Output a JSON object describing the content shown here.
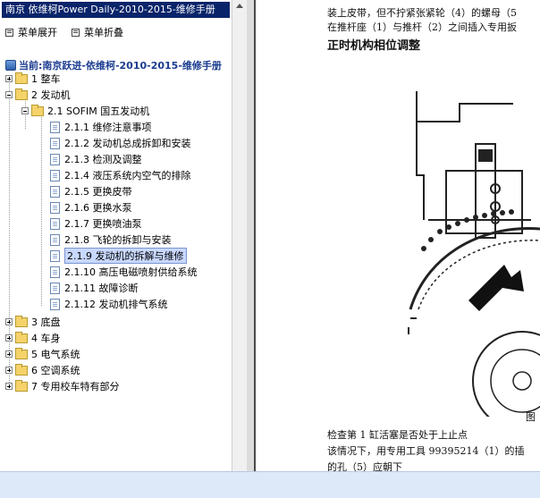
{
  "window": {
    "title": "南京 依维柯Power Daily-2010-2015-维修手册"
  },
  "menu": {
    "expand_label": "菜单展开",
    "collapse_label": "菜单折叠"
  },
  "current": {
    "label": "当前:南京跃进-依维柯-2010-2015-维修手册"
  },
  "tree": {
    "n1": "1 整车",
    "n2": "2 发动机",
    "n21": "2.1 SOFIM 国五发动机",
    "leaves": [
      "2.1.1 维修注意事项",
      "2.1.2 发动机总成拆卸和安装",
      "2.1.3 检测及调整",
      "2.1.4 液压系统内空气的排除",
      "2.1.5 更换皮带",
      "2.1.6 更换水泵",
      "2.1.7 更换喷油泵",
      "2.1.8 飞轮的拆卸与安装",
      "2.1.9 发动机的拆解与维修",
      "2.1.10 高压电磁喷射供给系统",
      "2.1.11 故障诊断",
      "2.1.12 发动机排气系统"
    ],
    "n3": "3 底盘",
    "n4": "4 车身",
    "n5": "5 电气系统",
    "n6": "6 空调系统",
    "n7": "7 专用校车特有部分"
  },
  "document": {
    "line1": "装上皮带，但不拧紧张紧轮（4）的螺母（5",
    "line2": "在推杆座（1）与推杆（2）之间插入专用扳",
    "heading": "正时机构相位调整",
    "caption": "图",
    "line3": "检查第 1 缸活塞是否处于上止点",
    "line4": "该情况下，用专用工具 99395214（1）的插",
    "line5": "的孔（5）应朝下"
  }
}
